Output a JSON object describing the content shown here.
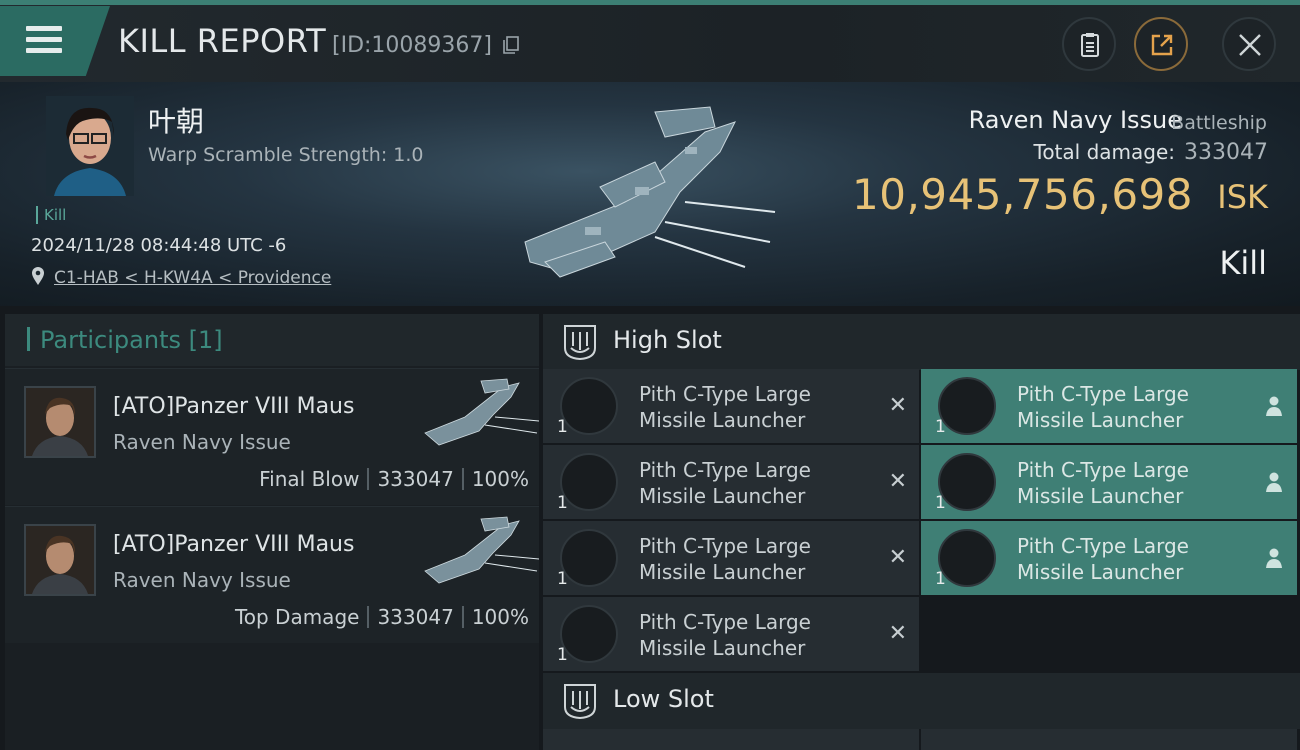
{
  "header": {
    "title": "KILL REPORT",
    "kill_id": "[ID:10089367]",
    "icons": [
      "menu-icon",
      "copy-icon",
      "clipboard-icon",
      "share-icon",
      "close-icon"
    ]
  },
  "victim": {
    "name": "叶朝",
    "warp_scramble": "Warp Scramble Strength: 1.0",
    "tag": "Kill",
    "datetime": "2024/11/28 08:44:48 UTC -6",
    "location": "C1-HAB < H-KW4A < Providence",
    "ship_name": "Raven Navy Issue",
    "ship_class": "Battleship",
    "total_damage_label": "Total damage:",
    "total_damage_value": "333047",
    "isk_value": "10,945,756,698",
    "isk_unit": "ISK",
    "result": "Kill"
  },
  "participants": {
    "title": "Participants",
    "count": "[1]",
    "rows": [
      {
        "name": "[ATO]Panzer VIII Maus",
        "ship": "Raven Navy Issue",
        "role": "Final Blow",
        "damage": "333047",
        "percent": "100%"
      },
      {
        "name": "[ATO]Panzer VIII Maus",
        "ship": "Raven Navy Issue",
        "role": "Top Damage",
        "damage": "333047",
        "percent": "100%"
      }
    ]
  },
  "high_slot": {
    "label": "High Slot",
    "items": [
      {
        "name_line1": "Pith C-Type Large",
        "name_line2": "Missile Launcher",
        "qty": "1",
        "state": "destroyed"
      },
      {
        "name_line1": "Pith C-Type Large",
        "name_line2": "Missile Launcher",
        "qty": "1",
        "state": "dropped"
      },
      {
        "name_line1": "Pith C-Type Large",
        "name_line2": "Missile Launcher",
        "qty": "1",
        "state": "destroyed"
      },
      {
        "name_line1": "Pith C-Type Large",
        "name_line2": "Missile Launcher",
        "qty": "1",
        "state": "dropped"
      },
      {
        "name_line1": "Pith C-Type Large",
        "name_line2": "Missile Launcher",
        "qty": "1",
        "state": "destroyed"
      },
      {
        "name_line1": "Pith C-Type Large",
        "name_line2": "Missile Launcher",
        "qty": "1",
        "state": "dropped"
      },
      {
        "name_line1": "Pith C-Type Large",
        "name_line2": "Missile Launcher",
        "qty": "1",
        "state": "destroyed"
      }
    ]
  },
  "low_slot": {
    "label": "Low Slot"
  },
  "colors": {
    "accent": "#3c8a7e",
    "isk": "#e7c277",
    "active_slot": "#3f7f75"
  }
}
